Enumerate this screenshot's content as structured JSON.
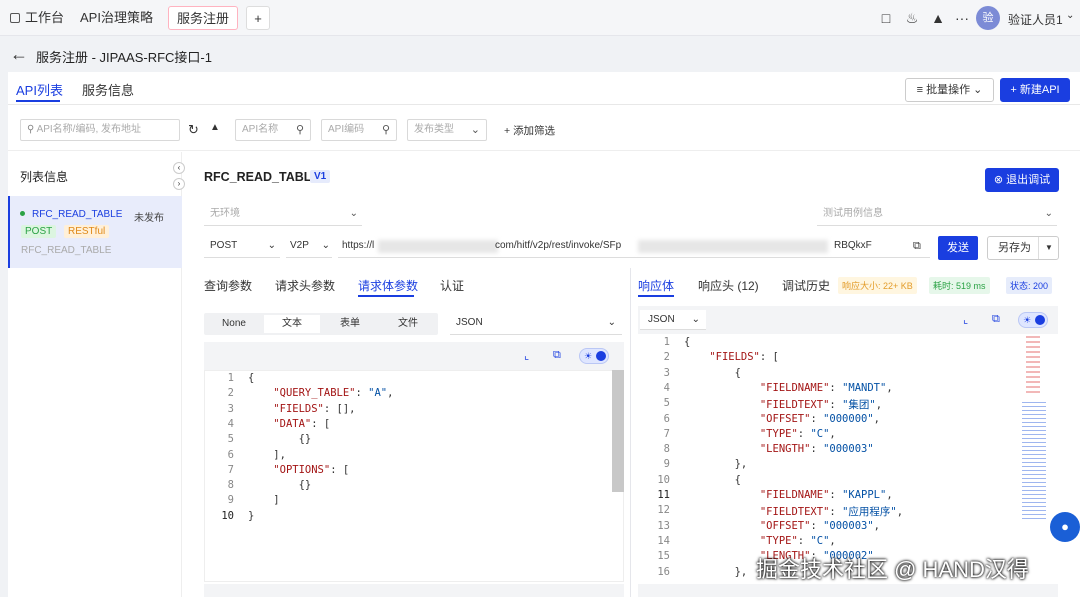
{
  "topbar": {
    "tabs": [
      {
        "label": "工作台",
        "icon": "home-grid-icon"
      },
      {
        "label": "API治理策略"
      },
      {
        "label": "服务注册"
      }
    ],
    "add_tab": "+",
    "user_avatar": "验",
    "user_name": "验证人员1",
    "more": "···"
  },
  "page": {
    "breadcrumb": "服务注册 - JIPAAS-RFC接口-1",
    "tabs": [
      "API列表",
      "服务信息"
    ],
    "batch_label": "批量操作",
    "new_api_label": "新建API",
    "filters": {
      "search_placeholder": "API名称/编码, 发布地址",
      "name_placeholder": "API名称",
      "code_placeholder": "API编码",
      "type_placeholder": "发布类型",
      "add_filter": "添加筛选"
    }
  },
  "left": {
    "title": "列表信息",
    "item": {
      "name": "RFC_READ_TABLE",
      "status": "未发布",
      "method": "POST",
      "style": "RESTful",
      "code": "RFC_READ_TABLE"
    }
  },
  "detail": {
    "api_name": "RFC_READ_TABLE",
    "version": "V1",
    "exit_debug": "退出调试",
    "env_placeholder": "无环境",
    "case_placeholder": "测试用例信息",
    "method": "POST",
    "protocol": "V2P",
    "url_prefix": "https://l",
    "url_mid": "com/hitf/v2p/rest/invoke/SFp",
    "url_suffix": "RBQkxF",
    "send": "发送",
    "save_as": "另存为"
  },
  "request": {
    "tabs": [
      "查询参数",
      "请求头参数",
      "请求体参数",
      "认证"
    ],
    "active_tab": 2,
    "body_types": [
      "None",
      "文本",
      "表单",
      "文件"
    ],
    "active_body_type": 1,
    "format": "JSON",
    "code": [
      {
        "n": "1",
        "t": "{"
      },
      {
        "n": "2",
        "t": "    \"QUERY_TABLE\": \"A\","
      },
      {
        "n": "3",
        "t": "    \"FIELDS\": [],"
      },
      {
        "n": "4",
        "t": "    \"DATA\": ["
      },
      {
        "n": "5",
        "t": "        {}"
      },
      {
        "n": "6",
        "t": "    ],"
      },
      {
        "n": "7",
        "t": "    \"OPTIONS\": ["
      },
      {
        "n": "8",
        "t": "        {}"
      },
      {
        "n": "9",
        "t": "    ]"
      },
      {
        "n": "10",
        "t": "}"
      }
    ]
  },
  "response": {
    "tabs": [
      "响应体",
      "响应头 (12)",
      "调试历史"
    ],
    "active_tab": 0,
    "size": "响应大小: 22+ KB",
    "time": "耗时: 519 ms",
    "status": "状态: 200",
    "format": "JSON",
    "code": [
      {
        "n": "1",
        "t": "{"
      },
      {
        "n": "2",
        "t": "    \"FIELDS\": ["
      },
      {
        "n": "3",
        "t": "        {"
      },
      {
        "n": "4",
        "t": "            \"FIELDNAME\": \"MANDT\","
      },
      {
        "n": "5",
        "t": "            \"FIELDTEXT\": \"集团\","
      },
      {
        "n": "6",
        "t": "            \"OFFSET\": \"000000\","
      },
      {
        "n": "7",
        "t": "            \"TYPE\": \"C\","
      },
      {
        "n": "8",
        "t": "            \"LENGTH\": \"000003\""
      },
      {
        "n": "9",
        "t": "        },"
      },
      {
        "n": "10",
        "t": "        {"
      },
      {
        "n": "11",
        "t": "            \"FIELDNAME\": \"KAPPL\","
      },
      {
        "n": "12",
        "t": "            \"FIELDTEXT\": \"应用程序\","
      },
      {
        "n": "13",
        "t": "            \"OFFSET\": \"000003\","
      },
      {
        "n": "14",
        "t": "            \"TYPE\": \"C\","
      },
      {
        "n": "15",
        "t": "            \"LENGTH\": \"000002\""
      },
      {
        "n": "16",
        "t": "        },"
      }
    ]
  },
  "watermark": "掘金技术社区 @ HAND汉得"
}
